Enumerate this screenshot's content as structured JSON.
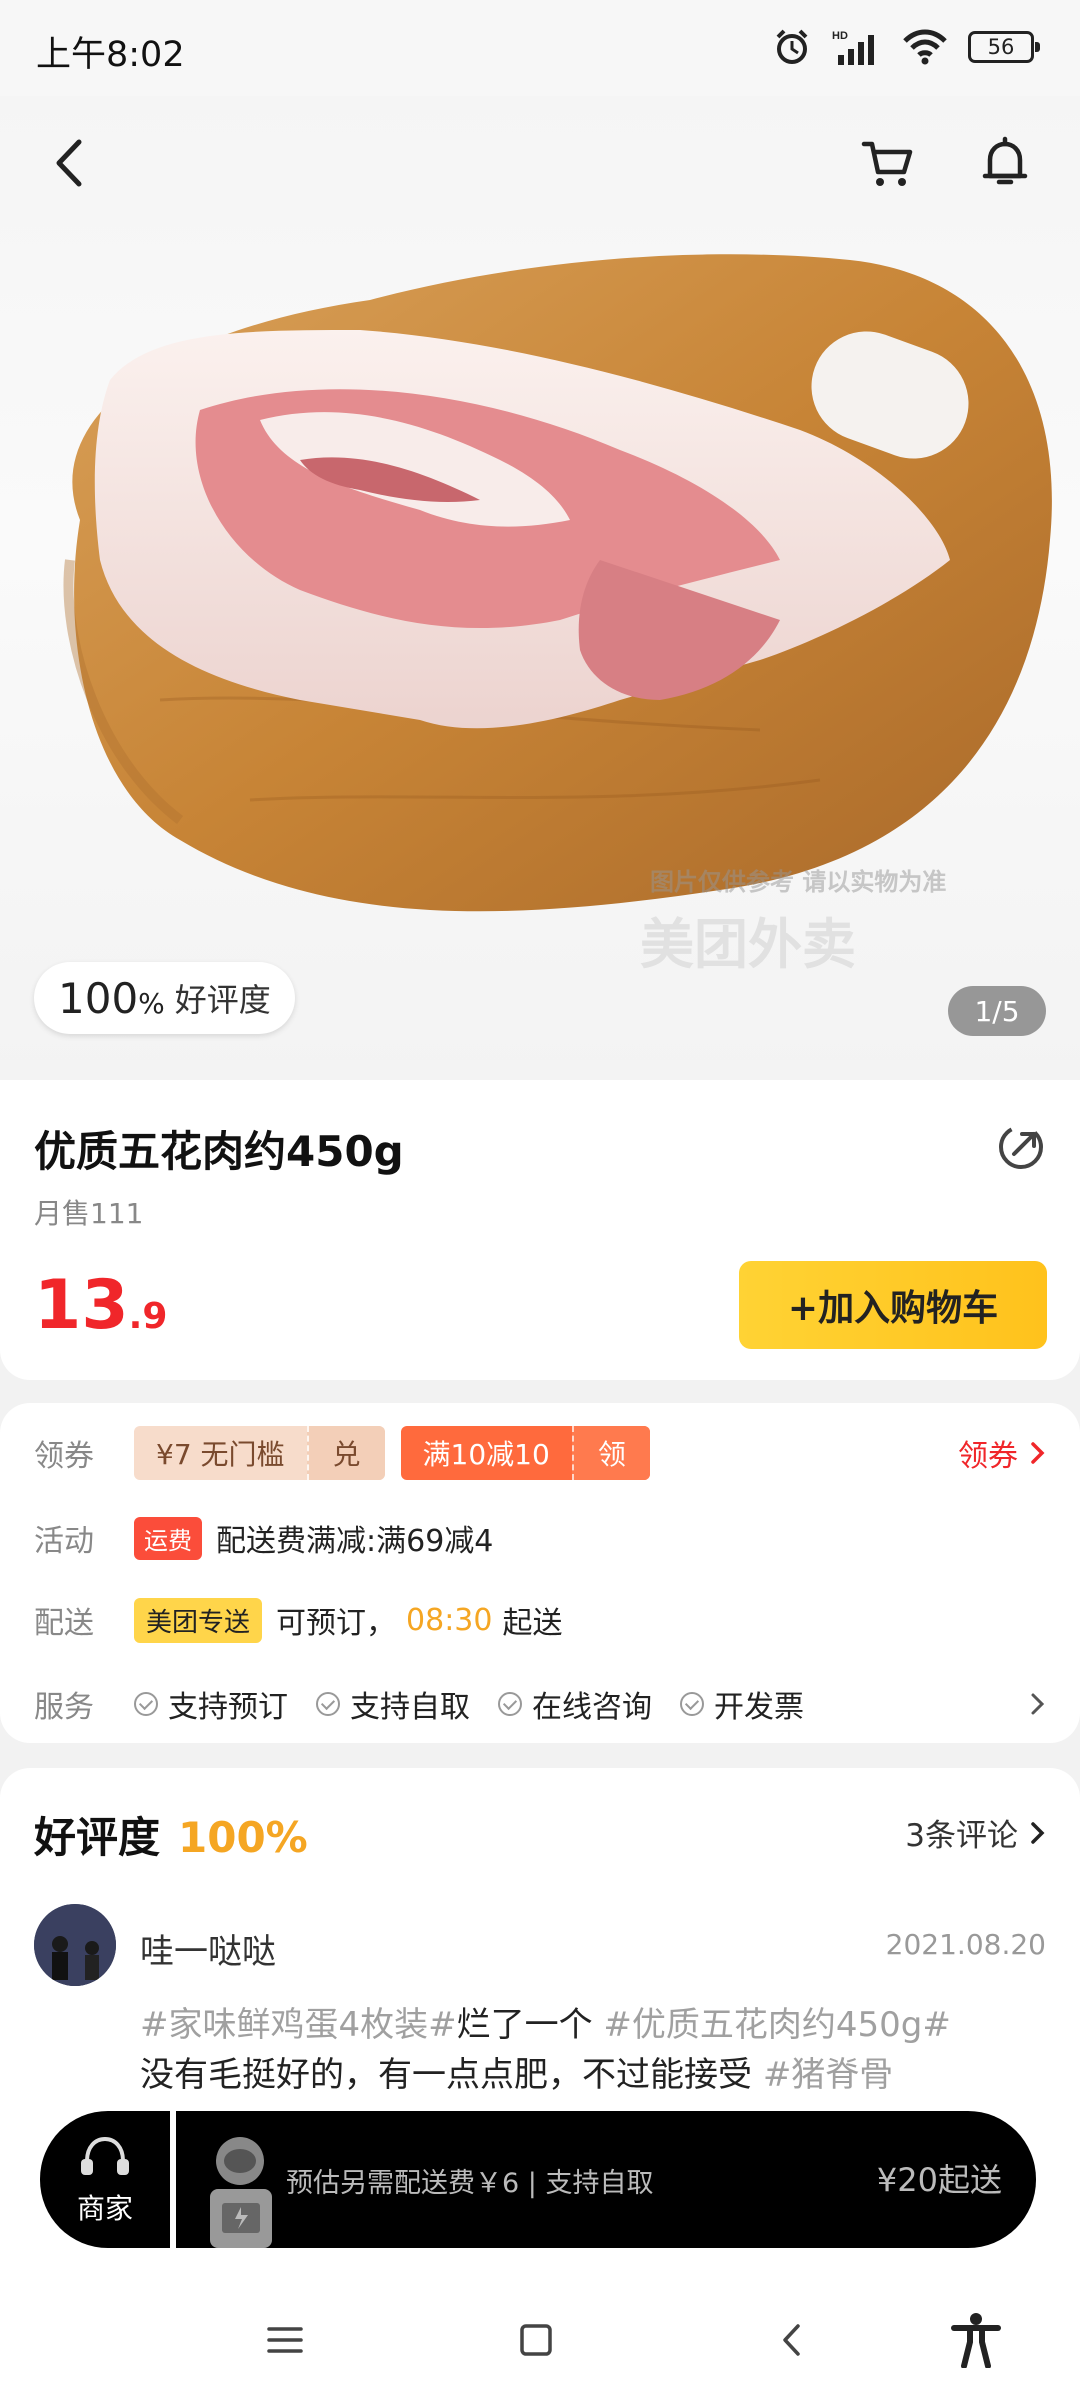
{
  "status_bar": {
    "time": "上午8:02",
    "battery": "56",
    "network": "HD"
  },
  "product": {
    "name": "优质五花肉约450g",
    "monthly_sales": "月售111",
    "price_int": "13",
    "price_dec": ".9",
    "add_cart_label": "+加入购物车",
    "rating_pct": "100",
    "rating_pct_unit": "%",
    "rating_label": "好评度",
    "image_index": "1/5",
    "watermark_line1": "图片仅供参考 请以实物为准",
    "watermark_line2": "美团外卖"
  },
  "promo": {
    "coupon_label": "领券",
    "coupon1_text": "¥7 无门槛",
    "coupon1_action": "兑",
    "coupon2_text": "满10减10",
    "coupon2_action": "领",
    "coupon_link": "领券",
    "activity_label": "活动",
    "activity_tag": "运费",
    "activity_text": "配送费满减:满69减4",
    "delivery_label": "配送",
    "delivery_tag": "美团专送",
    "delivery_text_pre": "可预订，",
    "delivery_time": "08:30",
    "delivery_text_post": "起送",
    "service_label": "服务",
    "services": [
      "支持预订",
      "支持自取",
      "在线咨询",
      "开发票"
    ]
  },
  "reviews": {
    "title": "好评度",
    "pct": "100%",
    "count": "3条评论",
    "items": [
      {
        "user": "哇一哒哒",
        "date": "2021.08.20",
        "tag1": "#家味鲜鸡蛋4枚装#",
        "text1": "烂了一个 ",
        "tag2": "#优质五花肉约450g#",
        "text2": "没有毛挺好的，有一点点肥，不过能接受 ",
        "tag3": "#猪脊骨"
      }
    ]
  },
  "bottom_bar": {
    "shop_label": "商家",
    "fee_text": "预估另需配送费￥6 | 支持自取",
    "min_order": "¥20起送"
  },
  "colors": {
    "accent_red": "#f0262a",
    "accent_yellow": "#ffc21c",
    "orange_text": "#f5a623"
  }
}
